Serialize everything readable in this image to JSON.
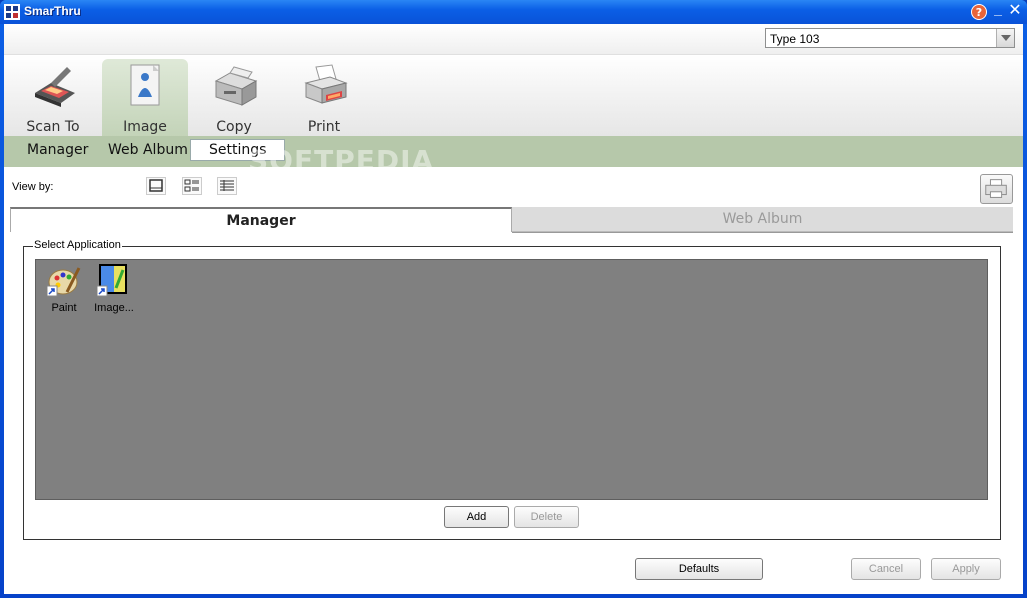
{
  "window": {
    "title": "SmarThru"
  },
  "device_combo": {
    "value": "Type 103"
  },
  "main_tabs": [
    {
      "label": "Scan To",
      "icon": "scanner-icon"
    },
    {
      "label": "Image",
      "icon": "image-icon",
      "active": true
    },
    {
      "label": "Copy",
      "icon": "copier-icon"
    },
    {
      "label": "Print",
      "icon": "printer-icon"
    }
  ],
  "sub_tabs": [
    {
      "label": "Manager"
    },
    {
      "label": "Web Album"
    },
    {
      "label": "Settings",
      "active": true
    }
  ],
  "watermark": "SOFTPEDIA",
  "view_by": {
    "label": "View by:"
  },
  "section_tabs": [
    {
      "label": "Manager",
      "active": true
    },
    {
      "label": "Web Album"
    }
  ],
  "group": {
    "legend": "Select Application"
  },
  "apps": [
    {
      "label": "Paint",
      "icon": "paint-icon"
    },
    {
      "label": "Image...",
      "icon": "image-editor-icon"
    }
  ],
  "buttons": {
    "add": "Add",
    "delete": "Delete",
    "defaults": "Defaults",
    "cancel": "Cancel",
    "apply": "Apply"
  },
  "colors": {
    "titlebar": "#0b5fe6",
    "subbar": "#b6c8aa",
    "active_tab": "#c3d3b8",
    "list_bg": "#808080"
  }
}
